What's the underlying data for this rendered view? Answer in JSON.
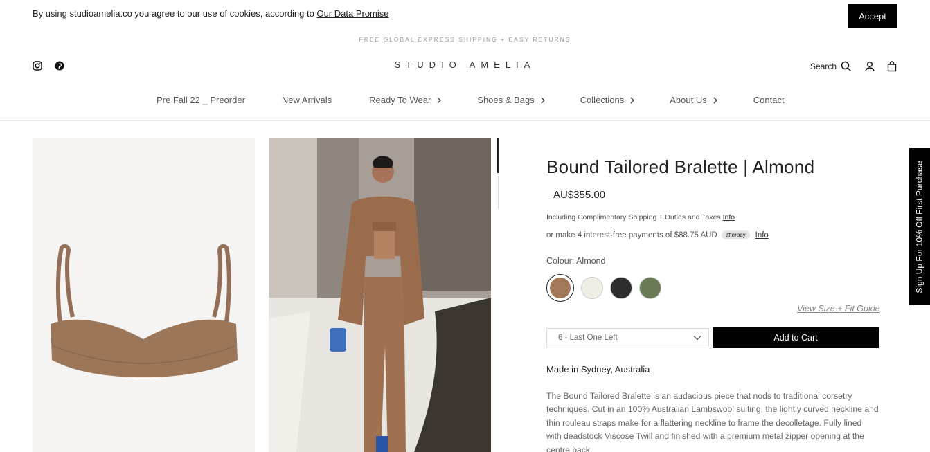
{
  "cookie": {
    "text": "By using studioamelia.co you agree to our use of cookies, according to ",
    "link": "Our Data Promise",
    "accept": "Accept"
  },
  "promo": "FREE GLOBAL EXPRESS SHIPPING + EASY RETURNS",
  "logo": "STUDIO AMELIA",
  "header": {
    "search_label": "Search"
  },
  "nav": [
    {
      "label": "Pre Fall 22 _ Preorder",
      "chevron": false
    },
    {
      "label": "New Arrivals",
      "chevron": false
    },
    {
      "label": "Ready To Wear",
      "chevron": true
    },
    {
      "label": "Shoes & Bags",
      "chevron": true
    },
    {
      "label": "Collections",
      "chevron": true
    },
    {
      "label": "About Us",
      "chevron": true
    },
    {
      "label": "Contact",
      "chevron": false
    }
  ],
  "product": {
    "title": "Bound Tailored Bralette | Almond",
    "price": "AU$355.00",
    "shipping_text": "Including Complimentary Shipping + Duties and Taxes ",
    "shipping_info": "Info",
    "afterpay_text": "or make 4 interest-free payments of $88.75 AUD",
    "afterpay_badge": "afterpay",
    "afterpay_info": "Info",
    "colour_label": "Colour: Almond",
    "swatches": [
      {
        "name": "Almond",
        "color": "#a2785a"
      },
      {
        "name": "Ivory",
        "color": "#efede6"
      },
      {
        "name": "Black",
        "color": "#2e2e2e"
      },
      {
        "name": "Olive",
        "color": "#6a7a56"
      }
    ],
    "size_guide": "View Size + Fit Guide",
    "size_selected": "6 - Last One Left",
    "add_to_cart": "Add to Cart",
    "made_in": "Made in Sydney, Australia",
    "description": "The Bound Tailored Bralette is an audacious piece that nods to traditional corsetry techniques. Cut in an 100% Australian Lambswool suiting, the lightly curved neckline and thin rouleau straps make for a flattering neckline to frame the decolletage. Fully lined with deadstock Viscose Twill and finished with a premium metal zipper opening at the centre back."
  },
  "signup_tab": "Sign Up For 10% Off First Purchase"
}
